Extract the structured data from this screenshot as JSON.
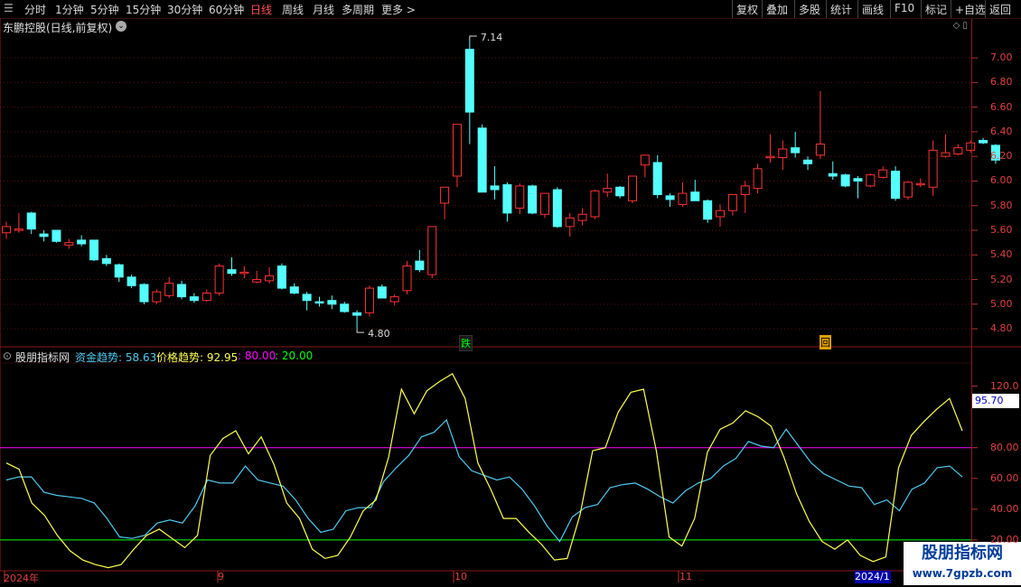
{
  "toolbar": {
    "periods": [
      "分时",
      "1分钟",
      "5分钟",
      "15分钟",
      "30分钟",
      "60分钟",
      "日线",
      "周线",
      "月线",
      "多周期",
      "更多 >"
    ],
    "active_period": "日线",
    "actions": [
      "复权",
      "叠加",
      "多股",
      "统计",
      "画线",
      "F10",
      "标记",
      "+自选",
      "返回"
    ]
  },
  "header": {
    "title": "东鹏控股(日线,前复权)",
    "icons": "◇ ▯"
  },
  "price_axis": {
    "labels": [
      "7.00",
      "6.80",
      "6.60",
      "6.40",
      "6.20",
      "6.00",
      "5.80",
      "5.60",
      "5.40",
      "5.20",
      "5.00",
      "4.80"
    ]
  },
  "indicator_axis": {
    "labels": [
      "120.0",
      "80.00",
      "60.00",
      "40.00",
      "20.00"
    ],
    "current_value": "95.70"
  },
  "annotations": {
    "high": "7.14",
    "low": "4.80",
    "marker_fall": "跌",
    "marker_return": "回"
  },
  "indicator": {
    "name": "股朋指标网",
    "fund_label": "资金趋势: 58.63",
    "price_label": "价格趋势: 92.95",
    "level_high": ": 80.00",
    "level_low": ": 20.00"
  },
  "dates": {
    "labels": [
      "2024年",
      "9",
      "10",
      "11"
    ],
    "highlight": "2024/1"
  },
  "watermark": {
    "text": "股朋指标网",
    "url": "www.7gpzb.com"
  },
  "colors": {
    "up": "#ff3232",
    "down": "#54ffff",
    "fund_line": "#4ec9f0",
    "price_line": "#ffff50",
    "level_high": "#ff00ff",
    "level_low": "#00ff00",
    "axis": "#e04040"
  },
  "chart_data": [
    {
      "type": "candlestick",
      "title": "东鹏控股(日线,前复权)",
      "ylim": [
        4.72,
        7.14
      ],
      "candles": [
        {
          "o": 5.58,
          "h": 5.67,
          "l": 5.53,
          "c": 5.63
        },
        {
          "o": 5.61,
          "h": 5.74,
          "l": 5.58,
          "c": 5.61
        },
        {
          "o": 5.74,
          "h": 5.75,
          "l": 5.57,
          "c": 5.61
        },
        {
          "o": 5.57,
          "h": 5.6,
          "l": 5.51,
          "c": 5.55
        },
        {
          "o": 5.6,
          "h": 5.6,
          "l": 5.5,
          "c": 5.51
        },
        {
          "o": 5.48,
          "h": 5.53,
          "l": 5.45,
          "c": 5.5
        },
        {
          "o": 5.52,
          "h": 5.56,
          "l": 5.47,
          "c": 5.49
        },
        {
          "o": 5.52,
          "h": 5.52,
          "l": 5.35,
          "c": 5.36
        },
        {
          "o": 5.37,
          "h": 5.4,
          "l": 5.31,
          "c": 5.33
        },
        {
          "o": 5.32,
          "h": 5.33,
          "l": 5.18,
          "c": 5.22
        },
        {
          "o": 5.22,
          "h": 5.24,
          "l": 5.13,
          "c": 5.15
        },
        {
          "o": 5.16,
          "h": 5.17,
          "l": 5.0,
          "c": 5.02
        },
        {
          "o": 5.02,
          "h": 5.12,
          "l": 5.0,
          "c": 5.1
        },
        {
          "o": 5.07,
          "h": 5.22,
          "l": 5.05,
          "c": 5.17
        },
        {
          "o": 5.16,
          "h": 5.19,
          "l": 5.04,
          "c": 5.06
        },
        {
          "o": 5.06,
          "h": 5.09,
          "l": 5.01,
          "c": 5.03
        },
        {
          "o": 5.03,
          "h": 5.12,
          "l": 5.02,
          "c": 5.09
        },
        {
          "o": 5.09,
          "h": 5.33,
          "l": 5.07,
          "c": 5.31
        },
        {
          "o": 5.28,
          "h": 5.38,
          "l": 5.23,
          "c": 5.25
        },
        {
          "o": 5.26,
          "h": 5.31,
          "l": 5.21,
          "c": 5.26
        },
        {
          "o": 5.18,
          "h": 5.27,
          "l": 5.17,
          "c": 5.2
        },
        {
          "o": 5.19,
          "h": 5.3,
          "l": 5.17,
          "c": 5.23
        },
        {
          "o": 5.31,
          "h": 5.33,
          "l": 5.12,
          "c": 5.13
        },
        {
          "o": 5.14,
          "h": 5.17,
          "l": 5.08,
          "c": 5.09
        },
        {
          "o": 5.08,
          "h": 5.1,
          "l": 4.95,
          "c": 5.03
        },
        {
          "o": 5.02,
          "h": 5.06,
          "l": 4.98,
          "c": 5.01
        },
        {
          "o": 5.03,
          "h": 5.07,
          "l": 4.96,
          "c": 5.0
        },
        {
          "o": 5.0,
          "h": 5.02,
          "l": 4.93,
          "c": 4.94
        },
        {
          "o": 4.93,
          "h": 4.95,
          "l": 4.8,
          "c": 4.91
        },
        {
          "o": 4.93,
          "h": 5.15,
          "l": 4.9,
          "c": 5.13
        },
        {
          "o": 5.14,
          "h": 5.16,
          "l": 5.05,
          "c": 5.05
        },
        {
          "o": 5.02,
          "h": 5.08,
          "l": 4.99,
          "c": 5.06
        },
        {
          "o": 5.11,
          "h": 5.35,
          "l": 5.08,
          "c": 5.31
        },
        {
          "o": 5.35,
          "h": 5.44,
          "l": 5.26,
          "c": 5.28
        },
        {
          "o": 5.24,
          "h": 5.63,
          "l": 5.21,
          "c": 5.63
        },
        {
          "o": 5.82,
          "h": 5.95,
          "l": 5.69,
          "c": 5.95
        },
        {
          "o": 6.04,
          "h": 6.46,
          "l": 5.95,
          "c": 6.46
        },
        {
          "o": 7.07,
          "h": 7.14,
          "l": 6.3,
          "c": 6.56
        },
        {
          "o": 6.43,
          "h": 6.46,
          "l": 5.91,
          "c": 5.91
        },
        {
          "o": 5.96,
          "h": 6.12,
          "l": 5.85,
          "c": 5.93
        },
        {
          "o": 5.97,
          "h": 5.99,
          "l": 5.67,
          "c": 5.74
        },
        {
          "o": 5.78,
          "h": 5.98,
          "l": 5.73,
          "c": 5.96
        },
        {
          "o": 5.96,
          "h": 5.97,
          "l": 5.73,
          "c": 5.74
        },
        {
          "o": 5.73,
          "h": 5.9,
          "l": 5.7,
          "c": 5.9
        },
        {
          "o": 5.93,
          "h": 5.95,
          "l": 5.62,
          "c": 5.63
        },
        {
          "o": 5.63,
          "h": 5.74,
          "l": 5.55,
          "c": 5.7
        },
        {
          "o": 5.68,
          "h": 5.78,
          "l": 5.64,
          "c": 5.73
        },
        {
          "o": 5.71,
          "h": 5.93,
          "l": 5.69,
          "c": 5.92
        },
        {
          "o": 5.91,
          "h": 6.06,
          "l": 5.87,
          "c": 5.94
        },
        {
          "o": 5.95,
          "h": 5.96,
          "l": 5.86,
          "c": 5.88
        },
        {
          "o": 5.84,
          "h": 6.04,
          "l": 5.82,
          "c": 6.04
        },
        {
          "o": 6.13,
          "h": 6.21,
          "l": 6.03,
          "c": 6.21
        },
        {
          "o": 6.15,
          "h": 6.21,
          "l": 5.86,
          "c": 5.89
        },
        {
          "o": 5.88,
          "h": 5.9,
          "l": 5.79,
          "c": 5.85
        },
        {
          "o": 5.81,
          "h": 5.99,
          "l": 5.79,
          "c": 5.9
        },
        {
          "o": 5.91,
          "h": 6.01,
          "l": 5.84,
          "c": 5.84
        },
        {
          "o": 5.84,
          "h": 5.85,
          "l": 5.66,
          "c": 5.69
        },
        {
          "o": 5.71,
          "h": 5.81,
          "l": 5.63,
          "c": 5.76
        },
        {
          "o": 5.76,
          "h": 5.89,
          "l": 5.72,
          "c": 5.89
        },
        {
          "o": 5.89,
          "h": 6.0,
          "l": 5.74,
          "c": 5.96
        },
        {
          "o": 5.94,
          "h": 6.14,
          "l": 5.9,
          "c": 6.1
        },
        {
          "o": 6.2,
          "h": 6.38,
          "l": 6.15,
          "c": 6.2
        },
        {
          "o": 6.19,
          "h": 6.33,
          "l": 6.09,
          "c": 6.26
        },
        {
          "o": 6.27,
          "h": 6.4,
          "l": 6.19,
          "c": 6.23
        },
        {
          "o": 6.17,
          "h": 6.2,
          "l": 6.09,
          "c": 6.14
        },
        {
          "o": 6.21,
          "h": 6.73,
          "l": 6.18,
          "c": 6.3
        },
        {
          "o": 6.06,
          "h": 6.16,
          "l": 6.01,
          "c": 6.04
        },
        {
          "o": 6.05,
          "h": 6.06,
          "l": 5.95,
          "c": 5.96
        },
        {
          "o": 6.02,
          "h": 6.04,
          "l": 5.86,
          "c": 6.0
        },
        {
          "o": 5.96,
          "h": 6.06,
          "l": 5.95,
          "c": 6.05
        },
        {
          "o": 6.03,
          "h": 6.12,
          "l": 6.02,
          "c": 6.09
        },
        {
          "o": 6.08,
          "h": 6.12,
          "l": 5.84,
          "c": 5.86
        },
        {
          "o": 5.87,
          "h": 6.0,
          "l": 5.85,
          "c": 5.99
        },
        {
          "o": 5.97,
          "h": 6.02,
          "l": 5.95,
          "c": 5.98
        },
        {
          "o": 5.95,
          "h": 6.33,
          "l": 5.88,
          "c": 6.25
        },
        {
          "o": 6.2,
          "h": 6.38,
          "l": 6.19,
          "c": 6.23
        },
        {
          "o": 6.22,
          "h": 6.3,
          "l": 6.21,
          "c": 6.27
        },
        {
          "o": 6.25,
          "h": 6.33,
          "l": 6.23,
          "c": 6.31
        },
        {
          "o": 6.33,
          "h": 6.35,
          "l": 6.3,
          "c": 6.31
        },
        {
          "o": 6.29,
          "h": 6.3,
          "l": 6.14,
          "c": 6.17
        }
      ]
    },
    {
      "type": "line",
      "title": "股朋指标网",
      "ylim": [
        0,
        135
      ],
      "series": [
        {
          "name": "资金趋势",
          "values": [
            59,
            61,
            61,
            51,
            49,
            48,
            47,
            44,
            34,
            22,
            21,
            23,
            31,
            33,
            31,
            42,
            59,
            57,
            57,
            68,
            59,
            57,
            55,
            46,
            34,
            25,
            27,
            39,
            41,
            41,
            58,
            67,
            75,
            87,
            90,
            98,
            74,
            65,
            62,
            59,
            61,
            53,
            42,
            29,
            19,
            35,
            41,
            43,
            54,
            56,
            57,
            53,
            48,
            44,
            52,
            57,
            60,
            68,
            73,
            84,
            81,
            80,
            92,
            81,
            70,
            63,
            59,
            55,
            54,
            43,
            46,
            39,
            53,
            57,
            67,
            68,
            61
          ]
        },
        {
          "name": "价格趋势",
          "values": [
            70,
            66,
            44,
            36,
            23,
            13,
            7,
            4,
            2,
            4,
            14,
            23,
            27,
            21,
            15,
            23,
            75,
            86,
            91,
            76,
            87,
            69,
            44,
            34,
            14,
            8,
            10,
            22,
            39,
            46,
            74,
            118,
            102,
            117,
            123,
            128,
            112,
            70,
            53,
            34,
            34,
            25,
            17,
            7,
            8,
            36,
            78,
            80,
            103,
            116,
            118,
            78,
            22,
            16,
            34,
            77,
            92,
            96,
            104,
            100,
            94,
            74,
            50,
            32,
            19,
            14,
            20,
            10,
            6,
            9,
            67,
            88,
            97,
            105,
            112,
            91
          ]
        }
      ],
      "levels": [
        80,
        20
      ]
    }
  ]
}
